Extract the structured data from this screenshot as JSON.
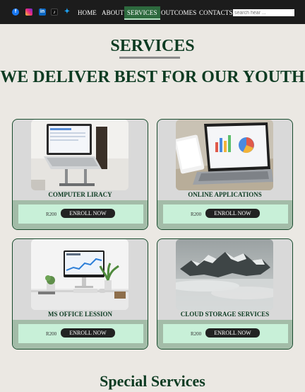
{
  "nav": {
    "social_icons": [
      "facebook-icon",
      "instagram-icon",
      "linkedin-icon",
      "tiktok-icon",
      "twitter-icon"
    ],
    "links": [
      "HOME",
      "ABOUT",
      "SERVICES",
      "OUTCOMES",
      "CONTACTS"
    ],
    "active": "SERVICES",
    "search_placeholder": "search hear ..."
  },
  "heading": "SERVICES",
  "subheading": "WE DELIVER BEST FOR OUR YOUTH",
  "cards": [
    {
      "title": "COMPUTER LIRACY",
      "price": "R200",
      "button": "ENROLL NOW",
      "image": "laptop-on-stand"
    },
    {
      "title": "ONLINE APPLICATIONS",
      "price": "R200",
      "button": "ENROLL NOW",
      "image": "laptop-with-charts"
    },
    {
      "title": "MS OFFICE LESSION",
      "price": "R200",
      "button": "ENROLL NOW",
      "image": "desktop-workspace"
    },
    {
      "title": "CLOUD STORAGE SERVICES",
      "price": "R200",
      "button": "ENROLL NOW",
      "image": "misty-mountain"
    }
  ],
  "special_heading": "Special Services",
  "colors": {
    "nav_bg": "#1c1c1c",
    "heading": "#0d3b22",
    "card_foot": "#a3bca8",
    "price_box": "#c8f0d8",
    "page_bg": "#ebe8e3"
  }
}
